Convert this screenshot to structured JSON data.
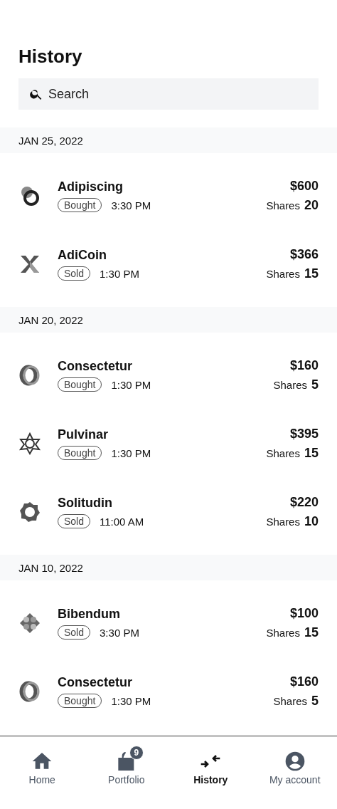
{
  "title": "History",
  "search": {
    "placeholder": "Search"
  },
  "groups": [
    {
      "date": "JAN 25, 2022",
      "transactions": [
        {
          "name": "Adipiscing",
          "type": "Bought",
          "time": "3:30 PM",
          "amount": "$600",
          "shares_label": "Shares",
          "shares": "20"
        },
        {
          "name": "AdiCoin",
          "type": "Sold",
          "time": "1:30 PM",
          "amount": "$366",
          "shares_label": "Shares",
          "shares": "15"
        }
      ]
    },
    {
      "date": "JAN 20, 2022",
      "transactions": [
        {
          "name": "Consectetur",
          "type": "Bought",
          "time": "1:30 PM",
          "amount": "$160",
          "shares_label": "Shares",
          "shares": "5"
        },
        {
          "name": "Pulvinar",
          "type": "Bought",
          "time": "1:30 PM",
          "amount": "$395",
          "shares_label": "Shares",
          "shares": "15"
        },
        {
          "name": "Solitudin",
          "type": "Sold",
          "time": "11:00 AM",
          "amount": "$220",
          "shares_label": "Shares",
          "shares": "10"
        }
      ]
    },
    {
      "date": "JAN 10, 2022",
      "transactions": [
        {
          "name": "Bibendum",
          "type": "Sold",
          "time": "3:30 PM",
          "amount": "$100",
          "shares_label": "Shares",
          "shares": "15"
        },
        {
          "name": "Consectetur",
          "type": "Bought",
          "time": "1:30 PM",
          "amount": "$160",
          "shares_label": "Shares",
          "shares": "5"
        }
      ]
    }
  ],
  "nav": [
    {
      "kind": "home",
      "label": "Home",
      "selected": false
    },
    {
      "kind": "portfolio",
      "label": "Portfolio",
      "selected": false,
      "badge": "9"
    },
    {
      "kind": "history",
      "label": "History",
      "selected": true
    },
    {
      "kind": "account",
      "label": "My account",
      "selected": false
    }
  ]
}
